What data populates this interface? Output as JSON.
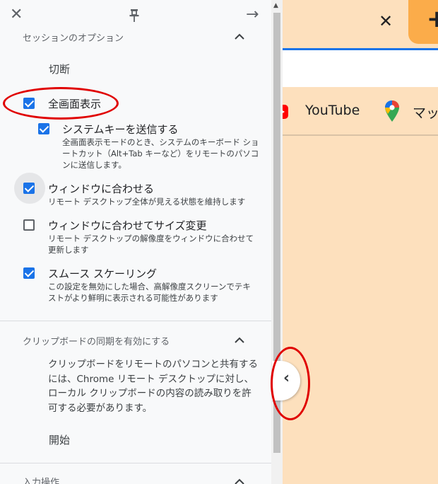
{
  "background": {
    "tab_close_icon": "✕",
    "new_tab_icon": "+",
    "bookmarks": [
      {
        "label": "YouTube",
        "icon": "youtube-icon"
      },
      {
        "label": "マップ",
        "icon": "maps-icon"
      }
    ]
  },
  "panel": {
    "top_icons": {
      "close": "✕",
      "pin": "📌",
      "forward": "→"
    },
    "session_options": {
      "title": "セッションのオプション",
      "disconnect": "切断",
      "fullscreen": {
        "label": "全画面表示",
        "checked": true
      },
      "send_system_keys": {
        "label": "システムキーを送信する",
        "description": "全画面表示モードのとき、システムのキーボード ショートカット（Alt+Tab キーなど）をリモートのパソコンに送信します。",
        "checked": true
      },
      "fit_to_window": {
        "label": "ウィンドウに合わせる",
        "description": "リモート デスクトップ全体が見える状態を維持します",
        "checked": true
      },
      "resize_to_fit": {
        "label": "ウィンドウに合わせてサイズ変更",
        "description": "リモート デスクトップの解像度をウィンドウに合わせて更新します",
        "checked": false
      },
      "smooth_scaling": {
        "label": "スムース スケーリング",
        "description": "この設定を無効にした場合、高解像度スクリーンでテキストがより鮮明に表示される可能性があります",
        "checked": true
      }
    },
    "clipboard": {
      "title": "クリップボードの同期を有効にする",
      "body": "クリップボードをリモートのパソコンと共有するには、Chrome リモート デスクトップに対し、ローカル クリップボードの内容の読み取りを許可する必要があります。",
      "start": "開始"
    },
    "input": {
      "title": "入力操作"
    }
  },
  "collapse_tab_icon": "‹",
  "colors": {
    "accent": "#1a73e8",
    "annotation": "#e00000",
    "background": "#fde0bd"
  }
}
